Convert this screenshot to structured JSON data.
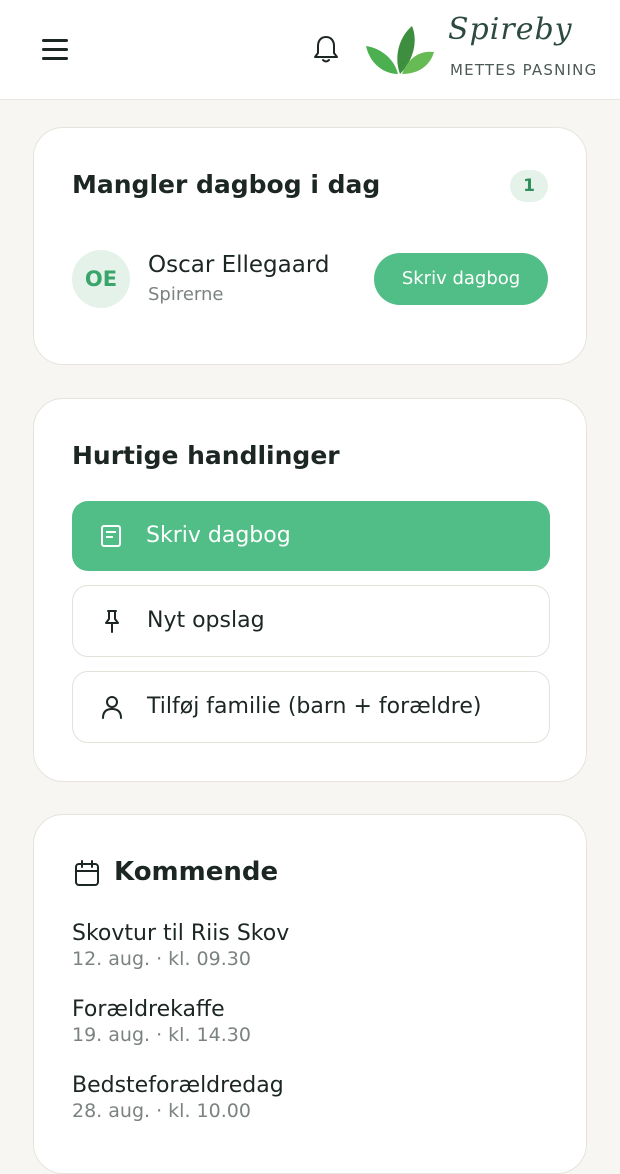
{
  "header": {
    "brand_name": "Spireby",
    "brand_sub": "METTES PASNING",
    "icons": {
      "menu": "hamburger-menu-icon",
      "bell": "bell-icon",
      "logo": "leaf-logo-icon"
    },
    "colors": {
      "accent": "#52be87",
      "brand_dark": "#2d4a3f"
    }
  },
  "missing": {
    "title": "Mangler dagbog i dag",
    "count": "1",
    "child": {
      "initials": "OE",
      "name": "Oscar Ellegaard",
      "group": "Spirerne",
      "button_label": "Skriv dagbog"
    }
  },
  "actions": {
    "title": "Hurtige handlinger",
    "items": [
      {
        "label": "Skriv dagbog",
        "icon": "note-icon"
      },
      {
        "label": "Nyt opslag",
        "icon": "pin-icon"
      },
      {
        "label": "Tilføj familie (barn + forældre)",
        "icon": "person-icon"
      }
    ]
  },
  "upcoming": {
    "title": "Kommende",
    "icon": "calendar-icon",
    "events": [
      {
        "title": "Skovtur til Riis Skov",
        "date": "12. aug. · kl. 09.30"
      },
      {
        "title": "Forældrekaffe",
        "date": "19. aug. · kl. 14.30"
      },
      {
        "title": "Bedsteforældredag",
        "date": "28. aug. · kl. 10.00"
      }
    ]
  }
}
